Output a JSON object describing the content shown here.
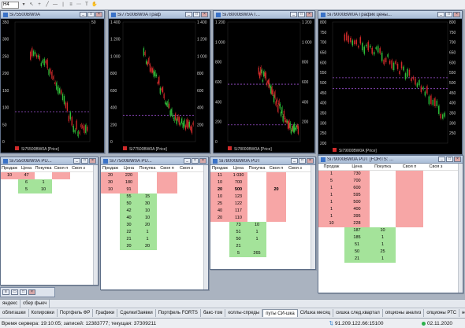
{
  "toolbar": {
    "timeframe": "H4"
  },
  "charts": [
    {
      "title": "Si75500BW0A",
      "legend": "Si75500BW0A [Price]",
      "ticks": [
        "350",
        "300",
        "250",
        "200",
        "150",
        "100",
        "50",
        "0"
      ],
      "right_ticks": [
        "50"
      ]
    },
    {
      "title": "Si77500BW0A Граф",
      "legend": "Si77500BW0A [Price]",
      "ticks": [
        "1 400",
        "1 200",
        "1 000",
        "800",
        "600",
        "400",
        "200",
        "0"
      ],
      "right_ticks": [
        "1 400",
        "1 200",
        "1 000",
        "800",
        "600",
        "400",
        "200"
      ]
    },
    {
      "title": "Si78000BW0A Г...",
      "legend": "Si78000BW0A [Price]",
      "ticks": [
        "1 200",
        "1 000",
        "800",
        "600",
        "400",
        "200",
        "0"
      ],
      "right_ticks": [
        "1 200",
        "1 000",
        "800",
        "600",
        "400",
        "200"
      ]
    },
    {
      "title": "Si79000BW0A График цены...",
      "legend": "Si79000BW0A [Price]",
      "ticks": [
        "800",
        "750",
        "700",
        "650",
        "600",
        "550",
        "500",
        "450",
        "400",
        "350",
        "300",
        "250",
        "200"
      ],
      "right_ticks": [
        "800",
        "750",
        "700",
        "650",
        "600",
        "550",
        "500",
        "450",
        "400",
        "350",
        "300",
        "250"
      ]
    }
  ],
  "books": [
    {
      "title": "Si75500BW0A PU...",
      "headers": [
        "Продаж",
        "Цена",
        "Покупка",
        "Своя п",
        "Своя з"
      ],
      "rows": [
        {
          "sell": "10",
          "price": "47",
          "buy": "",
          "type": "s"
        },
        {
          "sell": "",
          "price": "6",
          "buy": "1",
          "type": "b"
        },
        {
          "sell": "",
          "price": "5",
          "buy": "10",
          "type": "b"
        }
      ]
    },
    {
      "title": "Si77500BW0A PU...",
      "headers": [
        "Продаж",
        "Цена",
        "Покупка",
        "Своя п",
        "Своя з"
      ],
      "rows": [
        {
          "sell": "20",
          "price": "220",
          "buy": "",
          "type": "s"
        },
        {
          "sell": "30",
          "price": "180",
          "buy": "",
          "type": "s"
        },
        {
          "sell": "10",
          "price": "91",
          "buy": "",
          "type": "s"
        },
        {
          "sell": "",
          "price": "55",
          "buy": "15",
          "type": "b"
        },
        {
          "sell": "",
          "price": "50",
          "buy": "30",
          "type": "b"
        },
        {
          "sell": "",
          "price": "42",
          "buy": "10",
          "type": "b"
        },
        {
          "sell": "",
          "price": "40",
          "buy": "10",
          "type": "b"
        },
        {
          "sell": "",
          "price": "30",
          "buy": "20",
          "type": "b"
        },
        {
          "sell": "",
          "price": "22",
          "buy": "1",
          "type": "b"
        },
        {
          "sell": "",
          "price": "21",
          "buy": "1",
          "type": "b"
        },
        {
          "sell": "",
          "price": "20",
          "buy": "20",
          "type": "b"
        }
      ]
    },
    {
      "title": "Si78000BW0A PUT",
      "headers": [
        "Продаж",
        "Цена",
        "Покупка",
        "Своя п",
        "Своя з"
      ],
      "rows": [
        {
          "sell": "11",
          "price": "1 030",
          "buy": "",
          "type": "s"
        },
        {
          "sell": "10",
          "price": "700",
          "buy": "",
          "type": "s"
        },
        {
          "sell": "20",
          "price": "500",
          "buy": "",
          "own": "20",
          "type": "s",
          "bold": true
        },
        {
          "sell": "10",
          "price": "123",
          "buy": "",
          "type": "s"
        },
        {
          "sell": "25",
          "price": "122",
          "buy": "",
          "type": "s"
        },
        {
          "sell": "40",
          "price": "117",
          "buy": "",
          "type": "s"
        },
        {
          "sell": "20",
          "price": "110",
          "buy": "",
          "type": "s"
        },
        {
          "sell": "",
          "price": "73",
          "buy": "10",
          "type": "b"
        },
        {
          "sell": "",
          "price": "51",
          "buy": "1",
          "type": "b"
        },
        {
          "sell": "",
          "price": "50",
          "buy": "1",
          "type": "b"
        },
        {
          "sell": "",
          "price": "21",
          "buy": "",
          "type": "b"
        },
        {
          "sell": "",
          "price": "5",
          "buy": "265",
          "type": "b"
        }
      ]
    },
    {
      "title": "Si79000BW0A PUT [FORTS: ...",
      "headers": [
        "Продаж",
        "Цена",
        "Покупка",
        "Своя п",
        "Своя з"
      ],
      "rows": [
        {
          "sell": "1",
          "price": "730",
          "buy": "",
          "type": "s"
        },
        {
          "sell": "5",
          "price": "700",
          "buy": "",
          "type": "s"
        },
        {
          "sell": "1",
          "price": "600",
          "buy": "",
          "type": "s"
        },
        {
          "sell": "1",
          "price": "595",
          "buy": "",
          "type": "s"
        },
        {
          "sell": "1",
          "price": "500",
          "buy": "",
          "type": "s"
        },
        {
          "sell": "1",
          "price": "400",
          "buy": "",
          "type": "s"
        },
        {
          "sell": "1",
          "price": "395",
          "buy": "",
          "type": "s"
        },
        {
          "sell": "10",
          "price": "228",
          "buy": "",
          "type": "s"
        },
        {
          "sell": "",
          "price": "187",
          "buy": "10",
          "type": "b"
        },
        {
          "sell": "",
          "price": "185",
          "buy": "1",
          "type": "b"
        },
        {
          "sell": "",
          "price": "51",
          "buy": "1",
          "type": "b"
        },
        {
          "sell": "",
          "price": "50",
          "buy": "25",
          "type": "b"
        },
        {
          "sell": "",
          "price": "21",
          "buy": "1",
          "type": "b"
        }
      ]
    }
  ],
  "tabs_row1": [
    "яндекс",
    "сбер фьюч"
  ],
  "tabs_row2": [
    "облигашки",
    "Копировки",
    "Портфель ФР",
    "Графики",
    "Сделки/Заявки",
    "Портфель FORTS",
    "бакс-том",
    "коллы-спреды",
    "путы СИ-шка",
    "СИшка месяц",
    "сишка след.квартал",
    "опционы анализ",
    "опционы РТС",
    "нефть-"
  ],
  "active_tab": "путы СИ-шка",
  "status": {
    "server_time": "Время сервера: 19:10:05; записей: 12383777; текущая: 37309211",
    "connection": "91.209.122.66:15100",
    "date": "02.11.2020"
  }
}
